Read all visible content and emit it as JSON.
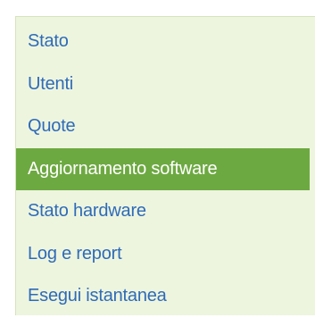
{
  "menu": {
    "active_index": 3,
    "colors": {
      "panel_background": "#eef5df",
      "link": "#2e6bb8",
      "active_background": "#6da941",
      "active_text": "#ffffff"
    },
    "items": [
      {
        "label": "Stato"
      },
      {
        "label": "Utenti"
      },
      {
        "label": "Quote"
      },
      {
        "label": "Aggiornamento software"
      },
      {
        "label": "Stato hardware"
      },
      {
        "label": "Log e report"
      },
      {
        "label": "Esegui istantanea"
      }
    ]
  }
}
